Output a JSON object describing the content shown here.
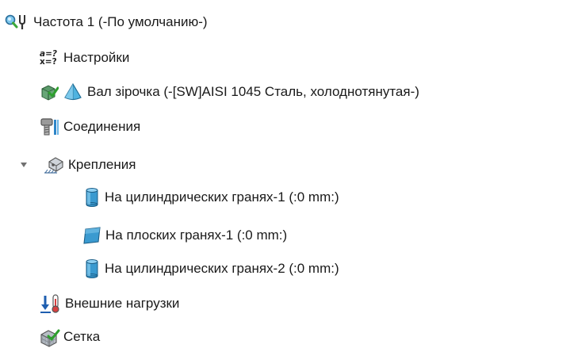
{
  "tree": {
    "root": {
      "label": "Частота 1 (-По умолчанию-)",
      "icon": "study-frequency-icon"
    },
    "settings": {
      "label": "Настройки",
      "icon": "formula-icon",
      "formula_line1": "a=?",
      "formula_line2": "x=?"
    },
    "part": {
      "label": "Вал зірочка (-[SW]AISI 1045 Сталь, холоднотянутая-)",
      "icon": "solid-body-material-icon"
    },
    "connections": {
      "label": "Соединения",
      "icon": "bolt-connector-icon"
    },
    "fixtures": {
      "label": "Крепления",
      "icon": "fixture-icon",
      "expanded": true,
      "children": [
        {
          "label": "На цилиндрических гранях-1 (:0 mm:)",
          "icon": "cylinder-face-icon"
        },
        {
          "label": "На плоских гранях-1 (:0 mm:)",
          "icon": "flat-face-icon"
        },
        {
          "label": "На цилиндрических гранях-2 (:0 mm:)",
          "icon": "cylinder-face-icon"
        }
      ]
    },
    "external_loads": {
      "label": "Внешние нагрузки",
      "icon": "external-load-thermometer-icon"
    },
    "mesh": {
      "label": "Сетка",
      "icon": "mesh-icon"
    }
  },
  "colors": {
    "text": "#1a1a1a",
    "face_blue": "#3a9ad0",
    "check_green": "#3aa83a",
    "load_blue": "#1f5fb0",
    "thermo_red": "#d64040"
  }
}
